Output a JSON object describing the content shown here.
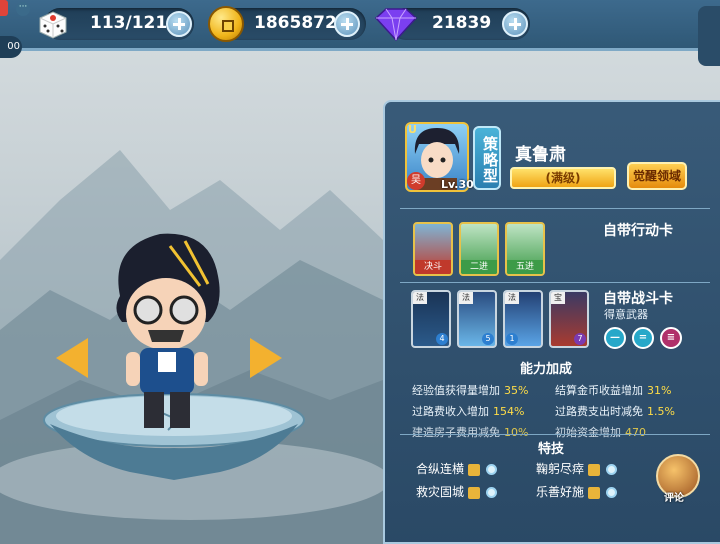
{
  "topbar": {
    "left_stub": "00",
    "dice_value": "113/121",
    "coin_value": "1865872",
    "gem_value": "21839"
  },
  "character": {
    "rarity": "U",
    "faction_badge": "吴",
    "level": "Lv.30",
    "type": "策略型",
    "name": "真鲁肃",
    "level_status": "(满级)",
    "awaken_button": "觉醒领域"
  },
  "action_cards": {
    "title": "自带行动卡",
    "cards": [
      {
        "label": "决斗",
        "color": "#c0392b"
      },
      {
        "label": "二进",
        "color": "#3d9b48"
      },
      {
        "label": "五进",
        "color": "#3d9b48"
      }
    ]
  },
  "battle_cards": {
    "title": "自带战斗卡",
    "weapon_label": "得意武器",
    "cards": [
      {
        "tag": "法",
        "cost": "24",
        "num": "4"
      },
      {
        "tag": "法",
        "cost": "",
        "num": "5"
      },
      {
        "tag": "法",
        "cost": "24",
        "num": "1"
      },
      {
        "tag": "宝",
        "cost": "",
        "num": "7"
      }
    ],
    "weapon_icons": [
      {
        "symbol": "—",
        "color": "#27a8c9"
      },
      {
        "symbol": "=",
        "color": "#27a8c9"
      },
      {
        "symbol": "≡",
        "color": "#b0306a"
      }
    ]
  },
  "bonuses": {
    "title": "能力加成",
    "items": [
      {
        "label": "经验值获得量增加",
        "value": "35%"
      },
      {
        "label": "结算金币收益增加",
        "value": "31%"
      },
      {
        "label": "过路费收入增加",
        "value": "154%"
      },
      {
        "label": "过路费支出时减免",
        "value": "1.5%"
      },
      {
        "label": "建造房子费用减免",
        "value": "10%"
      },
      {
        "label": "初始资金增加",
        "value": "470"
      }
    ]
  },
  "skills": {
    "title": "特技",
    "items": [
      {
        "label": "合纵连横"
      },
      {
        "label": "鞠躬尽瘁"
      },
      {
        "label": "救灾固城"
      },
      {
        "label": "乐善好施"
      }
    ]
  },
  "comment_label": "评论",
  "colors": {
    "accent_gold": "#f3b12f",
    "panel_blue": "#2c5070",
    "bonus_value": "#ffdd47"
  }
}
